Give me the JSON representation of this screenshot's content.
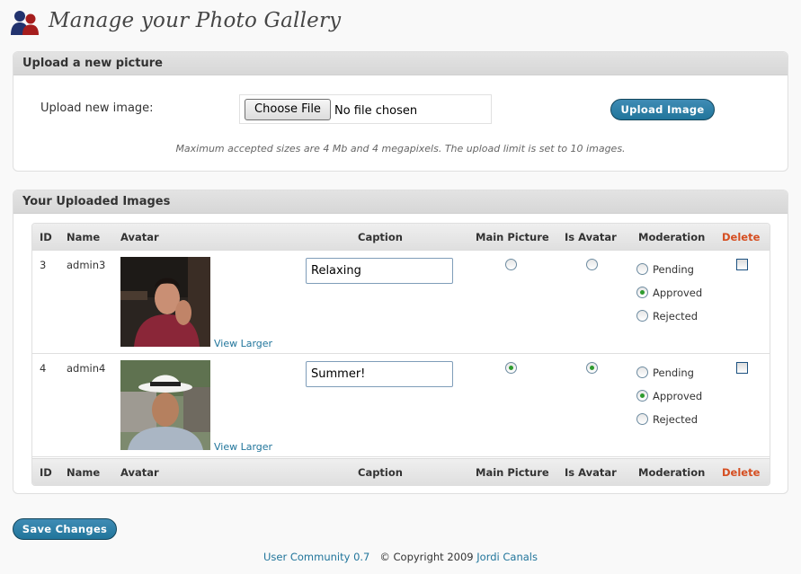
{
  "page": {
    "title": "Manage your Photo Gallery",
    "logo_icon": "users-icon"
  },
  "upload": {
    "section_title": "Upload a new picture",
    "field_label": "Upload new image:",
    "choose_file_label": "Choose File",
    "file_status": "No file chosen",
    "upload_button": "Upload Image",
    "note": "Maximum accepted sizes are 4 Mb and 4 megapixels. The upload limit is set to 10 images."
  },
  "images": {
    "section_title": "Your Uploaded Images",
    "columns": {
      "id": "ID",
      "name": "Name",
      "avatar": "Avatar",
      "caption": "Caption",
      "main_picture": "Main Picture",
      "is_avatar": "Is Avatar",
      "moderation": "Moderation",
      "delete": "Delete"
    },
    "moderation_options": [
      "Pending",
      "Approved",
      "Rejected"
    ],
    "view_larger_label": "View Larger",
    "rows": [
      {
        "id": "3",
        "name": "admin3",
        "caption": "Relaxing",
        "main_picture": false,
        "is_avatar": false,
        "moderation": "Approved",
        "delete": false
      },
      {
        "id": "4",
        "name": "admin4",
        "caption": "Summer!",
        "main_picture": true,
        "is_avatar": true,
        "moderation": "Approved",
        "delete": false
      }
    ]
  },
  "save_button": "Save Changes",
  "footer": {
    "plugin_link": "User Community 0.7",
    "copyright": "© Copyright 2009",
    "author_link": "Jordi Canals"
  },
  "colors": {
    "accent_blue": "#21759b",
    "delete_red": "#d54e21",
    "radio_checked": "#2e9b2e"
  }
}
